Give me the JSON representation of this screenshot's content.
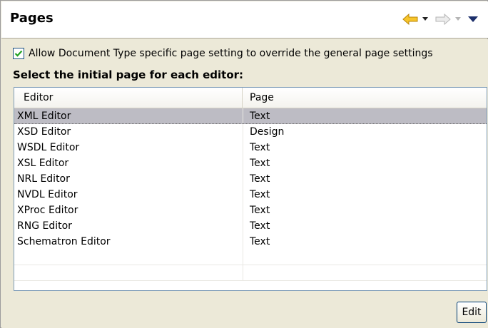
{
  "header": {
    "title": "Pages",
    "back_icon": "arrow-left-icon",
    "forward_icon": "arrow-right-icon",
    "menu_icon": "triangle-down-icon",
    "back_color": "#f7c52b",
    "forward_color": "#d8d8d8"
  },
  "options": {
    "override_label": "Allow Document Type specific page setting to override the general page settings",
    "override_checked": true,
    "check_color": "#21a121"
  },
  "section": {
    "label": "Select the initial page for each editor:"
  },
  "table": {
    "columns": [
      "Editor",
      "Page"
    ],
    "rows": [
      {
        "editor": "XML Editor",
        "page": "Text",
        "selected": true
      },
      {
        "editor": "XSD Editor",
        "page": "Design",
        "selected": false
      },
      {
        "editor": "WSDL Editor",
        "page": "Text",
        "selected": false
      },
      {
        "editor": "XSL Editor",
        "page": "Text",
        "selected": false
      },
      {
        "editor": "NRL Editor",
        "page": "Text",
        "selected": false
      },
      {
        "editor": "NVDL Editor",
        "page": "Text",
        "selected": false
      },
      {
        "editor": "XProc Editor",
        "page": "Text",
        "selected": false
      },
      {
        "editor": "RNG Editor",
        "page": "Text",
        "selected": false
      },
      {
        "editor": "Schematron Editor",
        "page": "Text",
        "selected": false
      }
    ]
  },
  "actions": {
    "edit_label": "Edit"
  }
}
